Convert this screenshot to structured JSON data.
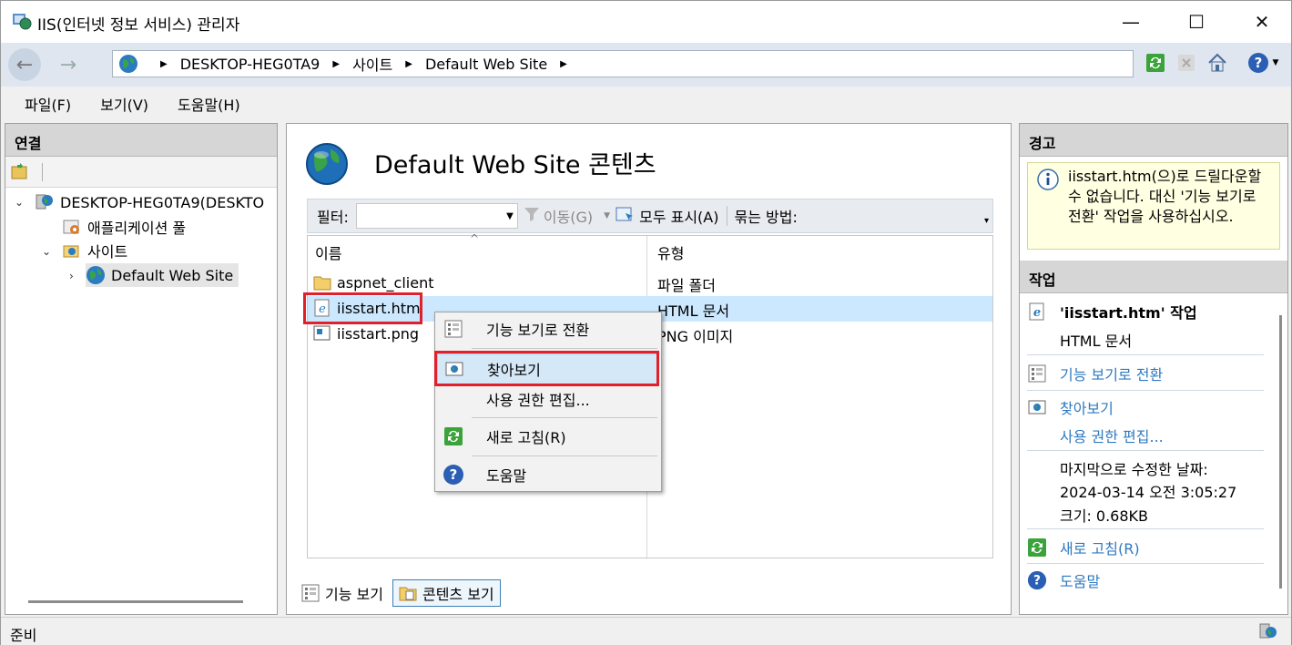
{
  "window": {
    "title": "IIS(인터넷 정보 서비스) 관리자",
    "minimize": "—",
    "maximize": "☐",
    "close": "✕"
  },
  "address": {
    "crumbs": [
      "DESKTOP-HEG0TA9",
      "사이트",
      "Default Web Site"
    ]
  },
  "menu": [
    "파일(F)",
    "보기(V)",
    "도움말(H)"
  ],
  "connections": {
    "header": "연결",
    "tree": [
      {
        "label": "DESKTOP-HEG0TA9(DESKTO",
        "icon": "server-icon"
      },
      {
        "label": "애플리케이션 풀",
        "icon": "app-pool-icon"
      },
      {
        "label": "사이트",
        "icon": "sites-folder-icon"
      },
      {
        "label": "Default Web Site",
        "icon": "globe-icon"
      }
    ]
  },
  "content": {
    "title": "Default Web Site 콘텐츠",
    "filter_label": "필터:",
    "move_label": "이동(G)",
    "show_all_label": "모두 표시(A)",
    "group_by_label": "묶는 방법:",
    "col_name": "이름",
    "col_type": "유형",
    "rows": [
      {
        "name": "aspnet_client",
        "type": "파일 폴더",
        "icon": "folder-icon"
      },
      {
        "name": "iisstart.htm",
        "type": "HTML 문서",
        "icon": "ie-document-icon"
      },
      {
        "name": "iisstart.png",
        "type": "PNG 이미지",
        "icon": "image-icon"
      }
    ],
    "tab_features": "기능 보기",
    "tab_content": "콘텐츠 보기"
  },
  "context_menu": {
    "items": [
      {
        "label": "기능 보기로 전환",
        "icon": "features-view-icon"
      },
      {
        "label": "찾아보기",
        "icon": "browse-icon"
      },
      {
        "label": "사용 권한 편집...",
        "icon": ""
      },
      {
        "label": "새로 고침(R)",
        "icon": "refresh-icon"
      },
      {
        "label": "도움말",
        "icon": "help-icon"
      }
    ]
  },
  "right": {
    "warning_header": "경고",
    "warning_text": "iisstart.htm(으)로 드릴다운할 수 없습니다. 대신 '기능 보기로 전환' 작업을 사용하십시오.",
    "actions_header": "작업",
    "file_action_title": "'iisstart.htm' 작업",
    "file_type": "HTML 문서",
    "switch_features": "기능 보기로 전환",
    "browse": "찾아보기",
    "edit_permissions": "사용 권한 편집...",
    "modified_label": "마지막으로 수정한 날짜:",
    "modified_value": "2024-03-14 오전 3:05:27",
    "size_label": "크기: 0.68KB",
    "refresh": "새로 고침(R)",
    "help": "도움말"
  },
  "status": {
    "text": "준비"
  },
  "colors": {
    "selection": "#cce8ff",
    "link": "#2f7ac0",
    "highlight_box": "#e0202a",
    "warning_bg": "#ffffe1"
  }
}
